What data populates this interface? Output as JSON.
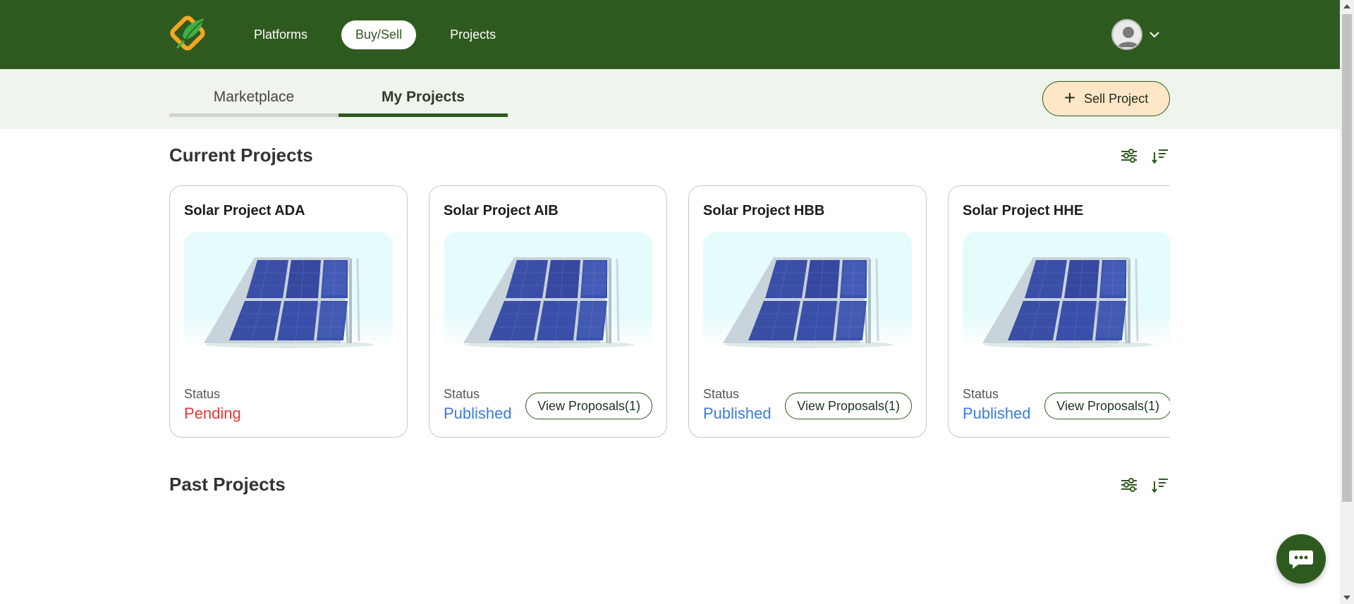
{
  "nav": {
    "items": [
      {
        "label": "Platforms",
        "active": false
      },
      {
        "label": "Buy/Sell",
        "active": true
      },
      {
        "label": "Projects",
        "active": false
      }
    ],
    "profile_icon": "user-avatar-icon",
    "dropdown_icon": "chevron-down-icon"
  },
  "tabs": [
    {
      "label": "Marketplace",
      "active": false
    },
    {
      "label": "My Projects",
      "active": true
    }
  ],
  "sell_button": {
    "label": "Sell Project",
    "icon": "plus-icon"
  },
  "current": {
    "title": "Current Projects",
    "filter_icon": "filter-sliders-icon",
    "sort_icon": "sort-icon",
    "cards": [
      {
        "title": "Solar Project ADA",
        "status_label": "Status",
        "status": "Pending",
        "proposals": ""
      },
      {
        "title": "Solar Project AIB",
        "status_label": "Status",
        "status": "Published",
        "proposals": "View Proposals(1)"
      },
      {
        "title": "Solar Project HBB",
        "status_label": "Status",
        "status": "Published",
        "proposals": "View Proposals(1)"
      },
      {
        "title": "Solar Project HHE",
        "status_label": "Status",
        "status": "Published",
        "proposals": "View Proposals(1)"
      }
    ]
  },
  "past": {
    "title": "Past Projects",
    "filter_icon": "filter-sliders-icon",
    "sort_icon": "sort-icon"
  },
  "chat": {
    "icon": "chat-bubble-icon"
  },
  "colors": {
    "brand_green": "#2f5a1f",
    "subbar_bg": "#eff5ec",
    "sell_bg": "#fde7c7",
    "pending": "#e53935",
    "published": "#3b7be0"
  }
}
